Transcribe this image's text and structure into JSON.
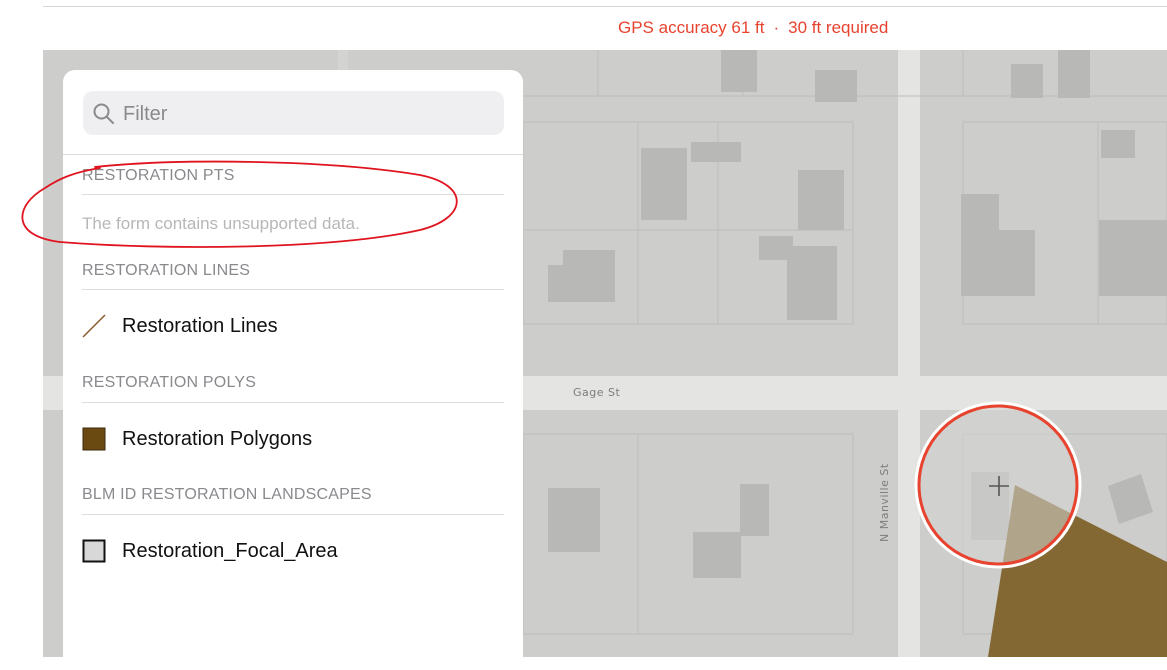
{
  "header": {
    "gps_accuracy": "GPS accuracy 61 ft",
    "separator": "·",
    "required": "30 ft required",
    "status_color": "#e8432f"
  },
  "map": {
    "streets": {
      "gage": "Gage St",
      "manville": "N Manville St"
    },
    "colors": {
      "background": "#cdcdcb",
      "road": "#e4e4e2",
      "building": "#b8b8b6",
      "polygon_fill": "#7a5a1e"
    },
    "crosshair_icon": "plus-icon"
  },
  "panel": {
    "search": {
      "placeholder": "Filter",
      "value": "",
      "icon": "search-icon"
    },
    "sections": [
      {
        "header": "RESTORATION PTS",
        "note": "The form contains unsupported data."
      },
      {
        "header": "RESTORATION LINES",
        "layer": {
          "label": "Restoration Lines",
          "symbol": "line-symbol",
          "color": "#8b5a2b"
        }
      },
      {
        "header": "RESTORATION POLYS",
        "layer": {
          "label": "Restoration Polygons",
          "symbol": "polygon-symbol",
          "color": "#6b4a12"
        }
      },
      {
        "header": "BLM ID RESTORATION LANDSCAPES",
        "layer": {
          "label": "Restoration_Focal_Area",
          "symbol": "area-symbol",
          "color": "#d8d8d8"
        }
      }
    ]
  },
  "annotation": {
    "color": "#e0141e"
  }
}
